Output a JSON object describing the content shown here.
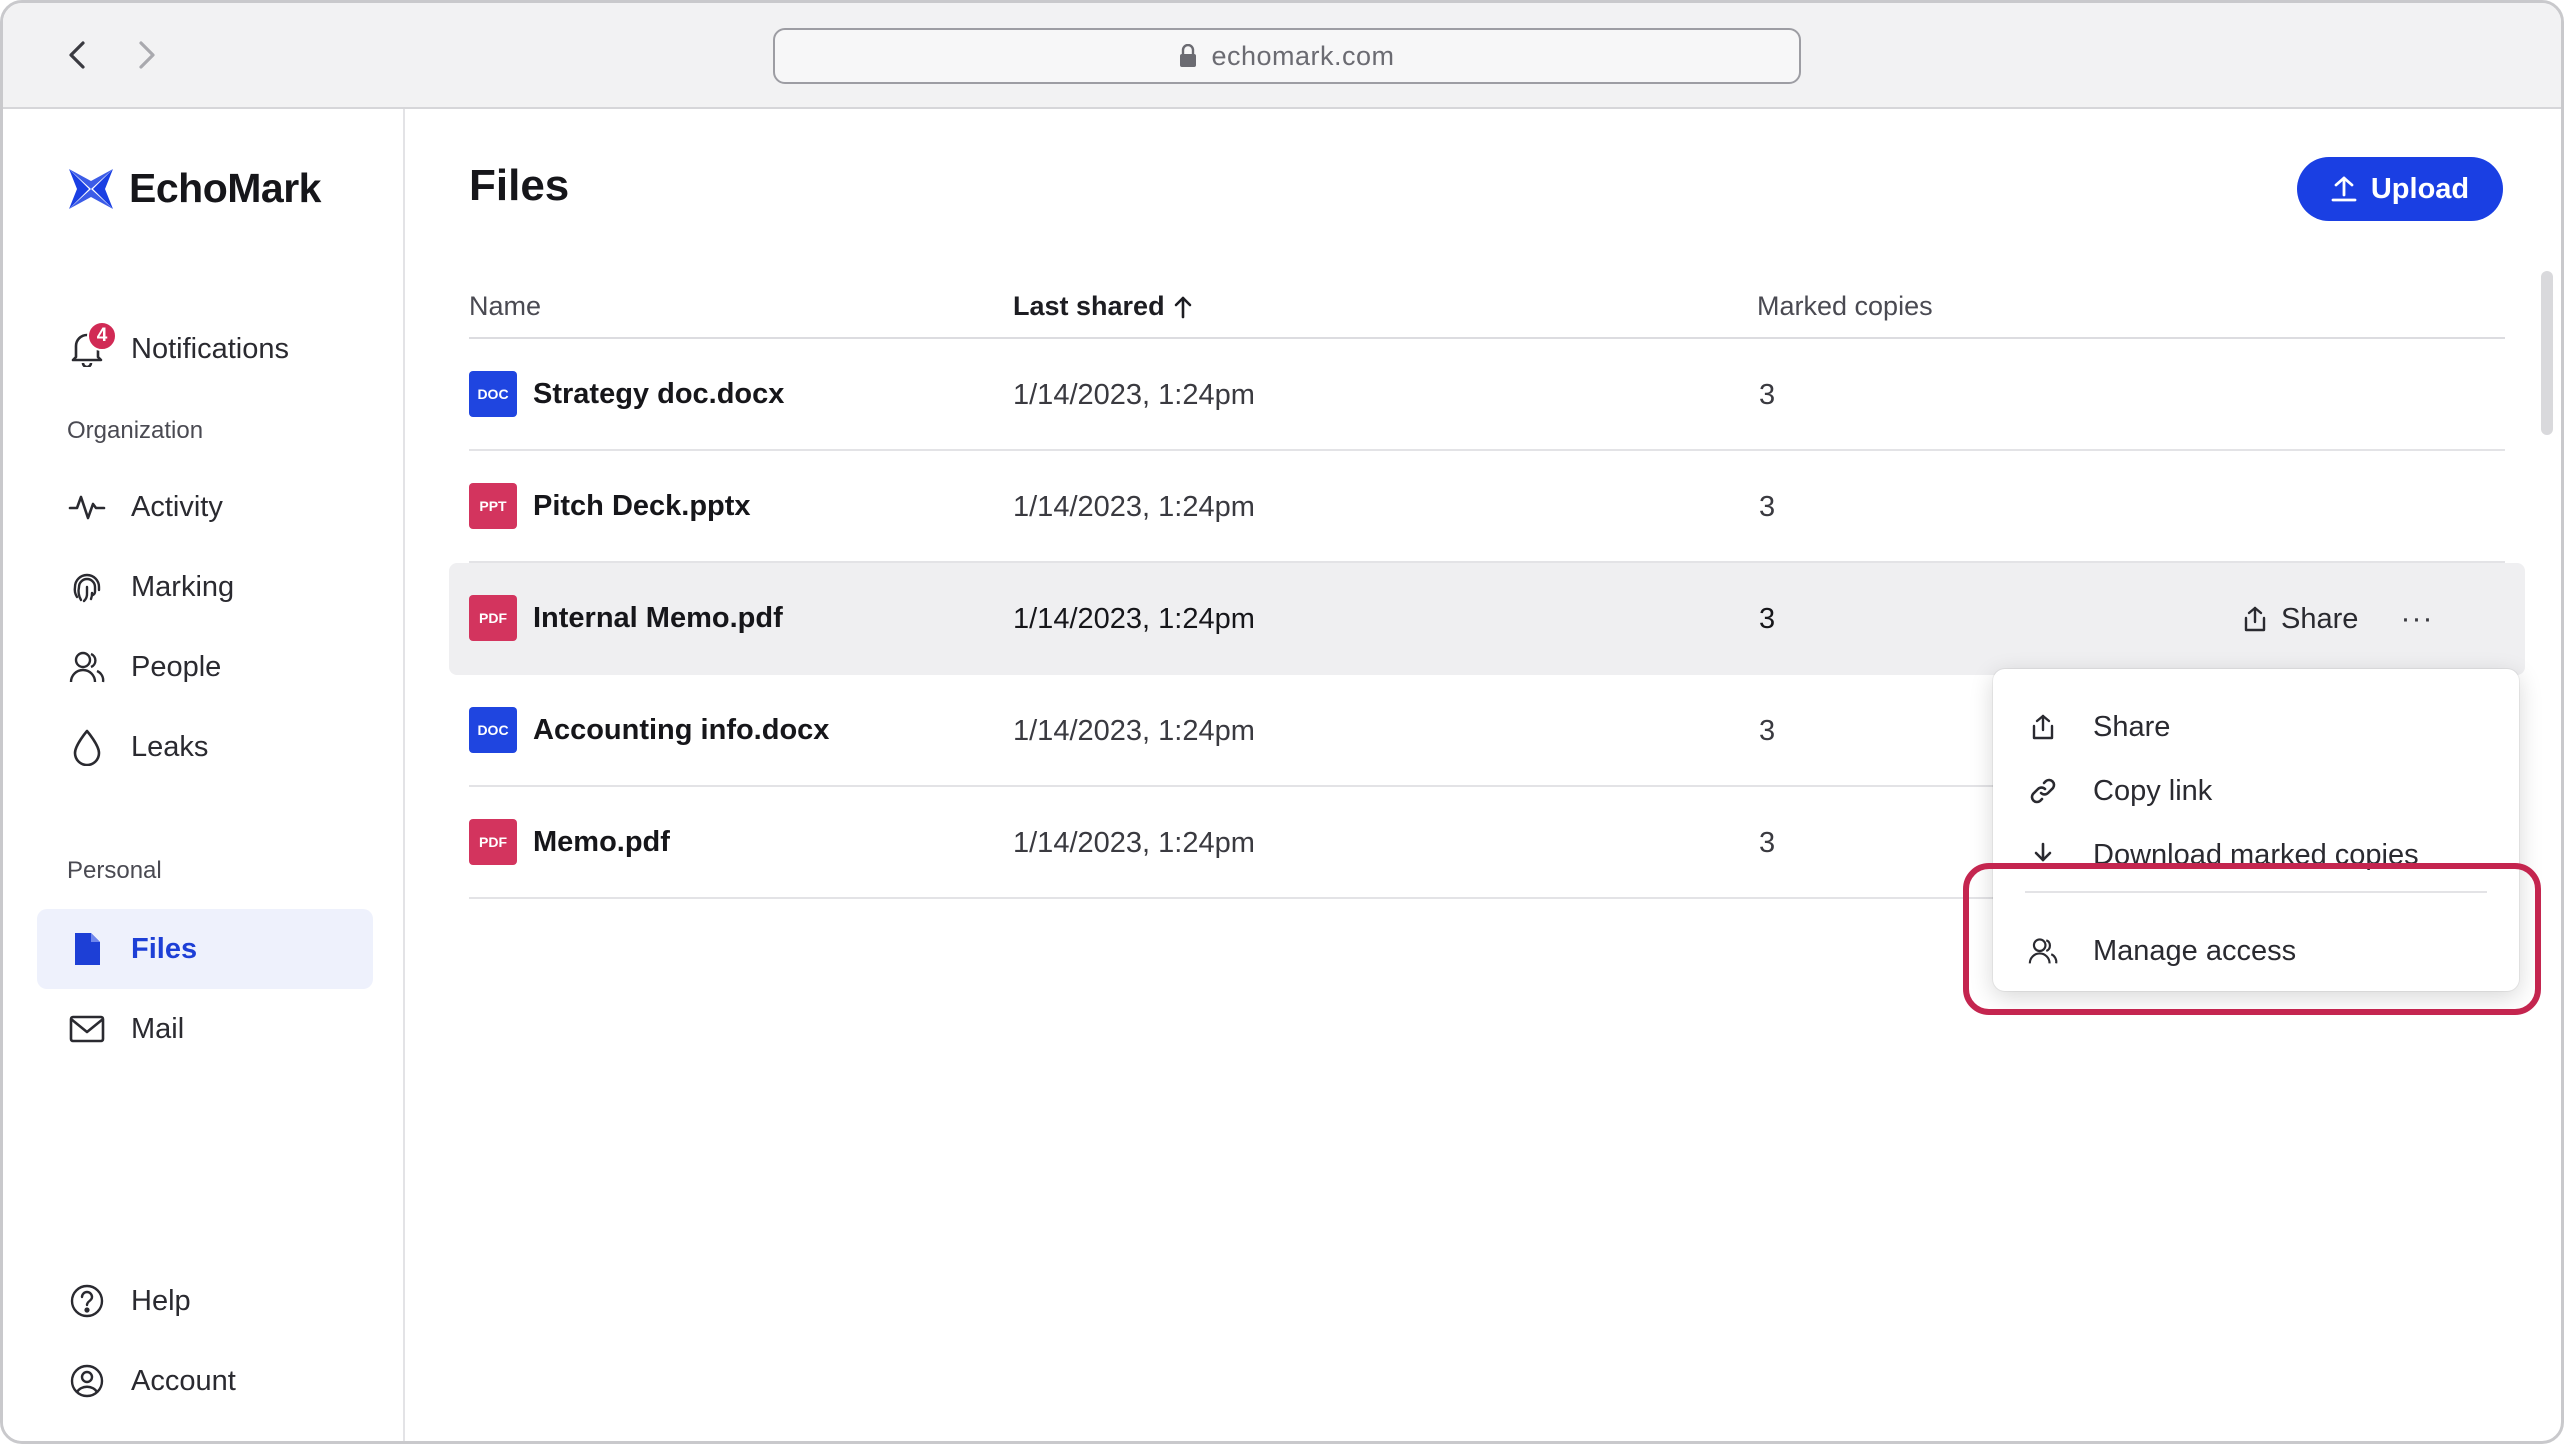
{
  "browser": {
    "url": "echomark.com",
    "icons": {
      "back": "chevron-left-icon",
      "forward": "chevron-right-icon",
      "lock": "lock-icon"
    }
  },
  "brand": {
    "name": "EchoMark",
    "color": "#1a3fe3"
  },
  "sidebar": {
    "notifications": {
      "label": "Notifications",
      "count": "4"
    },
    "organization_label": "Organization",
    "organization_items": [
      {
        "label": "Activity",
        "icon": "activity-icon"
      },
      {
        "label": "Marking",
        "icon": "fingerprint-icon"
      },
      {
        "label": "People",
        "icon": "people-icon"
      },
      {
        "label": "Leaks",
        "icon": "droplet-icon"
      }
    ],
    "personal_label": "Personal",
    "personal_items": [
      {
        "label": "Files",
        "icon": "file-icon",
        "active": true
      },
      {
        "label": "Mail",
        "icon": "mail-icon"
      }
    ],
    "footer_items": [
      {
        "label": "Help",
        "icon": "help-icon"
      },
      {
        "label": "Account",
        "icon": "account-icon"
      }
    ]
  },
  "main": {
    "title": "Files",
    "upload_label": "Upload",
    "columns": {
      "name": "Name",
      "last_shared": "Last shared",
      "marked_copies": "Marked copies"
    },
    "files": [
      {
        "type": "DOC",
        "name": "Strategy doc.docx",
        "last_shared": "1/14/2023, 1:24pm",
        "copies": "3"
      },
      {
        "type": "PPT",
        "name": "Pitch Deck.pptx",
        "last_shared": "1/14/2023, 1:24pm",
        "copies": "3"
      },
      {
        "type": "PDF",
        "name": "Internal Memo.pdf",
        "last_shared": "1/14/2023, 1:24pm",
        "copies": "3"
      },
      {
        "type": "DOC",
        "name": "Accounting info.docx",
        "last_shared": "1/14/2023, 1:24pm",
        "copies": "3"
      },
      {
        "type": "PDF",
        "name": "Memo.pdf",
        "last_shared": "1/14/2023, 1:24pm",
        "copies": "3"
      }
    ],
    "row_share_label": "Share",
    "row_more_label": "···"
  },
  "menu": {
    "items": [
      {
        "label": "Share",
        "icon": "share-icon"
      },
      {
        "label": "Copy link",
        "icon": "link-icon"
      },
      {
        "label": "Download marked copies",
        "icon": "download-icon"
      },
      {
        "label": "Manage access",
        "icon": "people-icon"
      }
    ]
  },
  "colors": {
    "accent": "#1a3fe3",
    "highlight": "#c4254f",
    "doc": "#1f45e0",
    "pdf": "#d3345e"
  }
}
